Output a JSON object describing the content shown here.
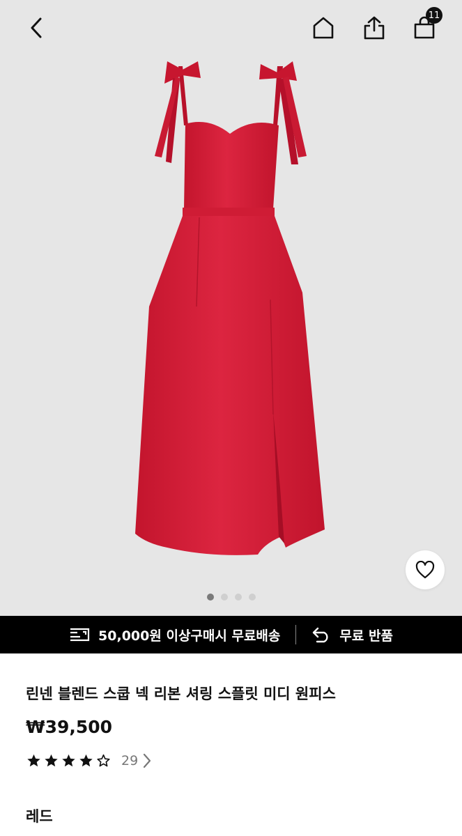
{
  "header": {
    "back_icon": "chevron-left-icon",
    "home_icon": "home-icon",
    "share_icon": "share-icon",
    "cart_icon": "shopping-bag-icon",
    "cart_count": "11"
  },
  "gallery": {
    "image": "red-midi-dress-photo",
    "total_images": 4,
    "active_index": 0,
    "wishlist_icon": "heart-icon"
  },
  "promo": {
    "shipping_icon": "shipping-icon",
    "shipping_text": "50,000원 이상구매시 무료배송",
    "return_icon": "return-arrow-icon",
    "return_text": "무료 반품"
  },
  "product": {
    "title": "린넨 블렌드 스쿱 넥 리본 셔링 스플릿  미디 원피스",
    "price": "₩39,500",
    "rating": 4,
    "rating_max": 5,
    "review_count": "29",
    "color_label": "레드"
  },
  "colors": {
    "dress": "#d01b34",
    "background": "#e6e6e6",
    "promo_bar": "#000000"
  }
}
